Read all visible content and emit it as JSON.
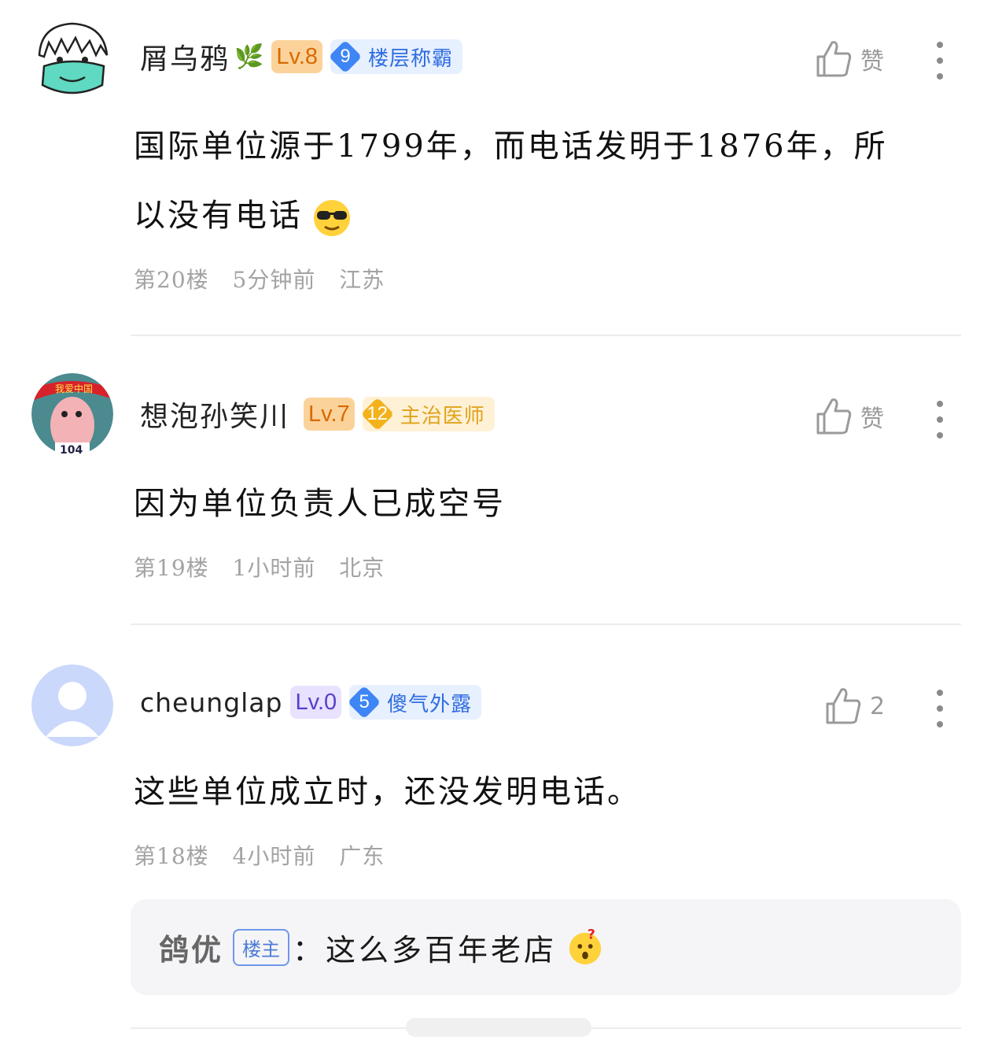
{
  "comments": [
    {
      "username": "屑乌鸦",
      "level": "Lv.8",
      "badge_num": "9",
      "badge_title": "楼层称霸",
      "like_label": "赞",
      "content_line1": "国际单位源于1799年，而电话发明于1876年，所",
      "content_line2": "以没有电话",
      "floor": "第20楼",
      "time": "5分钟前",
      "location": "江苏"
    },
    {
      "username": "想泡孙笑川",
      "level": "Lv.7",
      "badge_num": "12",
      "badge_title": "主治医师",
      "like_label": "赞",
      "content_line1": "因为单位负责人已成空号",
      "floor": "第19楼",
      "time": "1小时前",
      "location": "北京",
      "avatar_text": "我爱中国",
      "avatar_number": "104"
    },
    {
      "username": "cheunglap",
      "level": "Lv.0",
      "badge_num": "5",
      "badge_title": "傻气外露",
      "like_label": "2",
      "content_line1": "这些单位成立时，还没发明电话。",
      "floor": "第18楼",
      "time": "4小时前",
      "location": "广东",
      "reply": {
        "name": "鸽优",
        "tag": "楼主",
        "text": "：这么多百年老店"
      }
    }
  ],
  "icons": [
    "thumbs-up-icon",
    "more-vertical-icon",
    "sunglasses-emoji-icon",
    "confused-emoji-icon",
    "leaf-icon"
  ]
}
